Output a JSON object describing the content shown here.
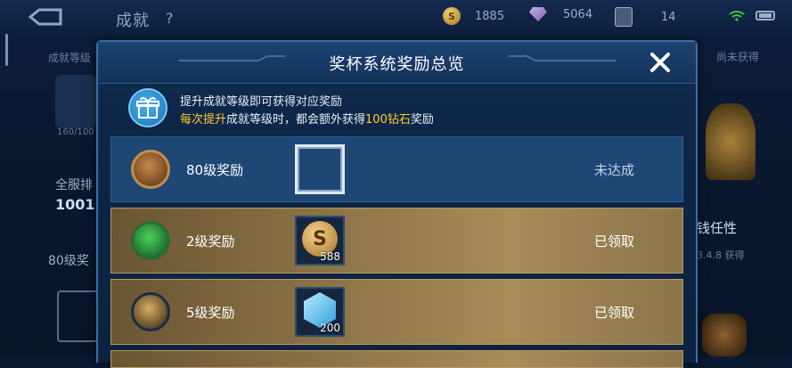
{
  "header": {
    "title": "成就",
    "help": "?",
    "gold_coins": "1885",
    "gems": "5064",
    "cards": "14"
  },
  "left_panel": {
    "tab": "成就等级",
    "progress": "160/100",
    "rank_label": "全服排",
    "rank_value": "1001",
    "level_tag": "80级奖"
  },
  "right_panel": {
    "tab": "尚未获得",
    "name": "钱任性",
    "date": "3.4.8 获得"
  },
  "modal": {
    "title": "奖杯系统奖励总览",
    "info_line1": "提升成就等级即可获得对应奖励",
    "info_line2_highlight1": "每次提升",
    "info_line2_mid": "成就等级时，都会额外获得",
    "info_line2_highlight2": "100钻石",
    "info_line2_end": "奖励"
  },
  "rewards": [
    {
      "label": "80级奖励",
      "status": "未达成",
      "state": "pending",
      "qty": ""
    },
    {
      "label": "2级奖励",
      "status": "已领取",
      "state": "claimed",
      "qty": "588"
    },
    {
      "label": "5级奖励",
      "status": "已领取",
      "state": "claimed",
      "qty": "200"
    }
  ],
  "colors": {
    "accent_gold": "#ffcc33",
    "pending_row": "#1e4775",
    "claimed_row": "#8e7547"
  },
  "icons": {
    "close": "close-icon",
    "gift": "gift-icon",
    "back": "back-arrow-icon"
  }
}
